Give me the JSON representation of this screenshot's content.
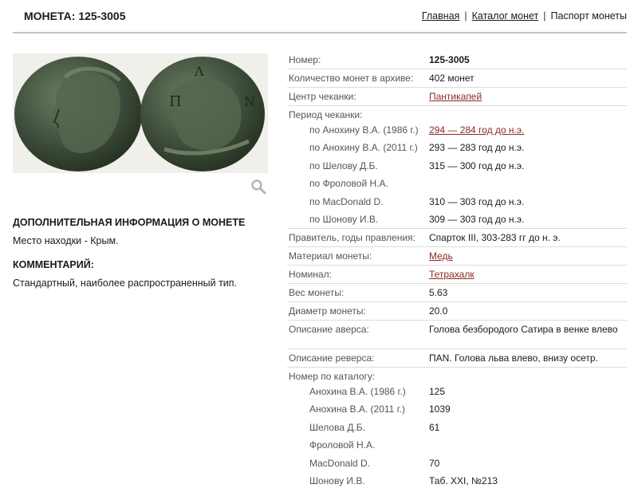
{
  "header": {
    "title": "МОНЕТА: 125-3005",
    "breadcrumb": {
      "home": "Главная",
      "catalog": "Каталог монет",
      "current": "Паспорт монеты",
      "separator": "|"
    }
  },
  "left": {
    "extra_heading": "ДОПОЛНИТЕЛЬНАЯ ИНФОРМАЦИЯ О МОНЕТЕ",
    "find_place": "Место находки - Крым.",
    "comment_heading": "КОММЕНТАРИЙ:",
    "comment": "Стандартный, наиболее распространенный тип.",
    "zoom_icon": "magnifier-icon",
    "coin_colors": {
      "metal": "#3e4e3c",
      "highlight": "#6d7d62",
      "background": "#f0efe9"
    }
  },
  "details": {
    "number": {
      "label": "Номер:",
      "value": "125-3005"
    },
    "count": {
      "label": "Количество монет в архиве:",
      "value": "402 монет"
    },
    "mint": {
      "label": "Центр чеканки:",
      "value": "Пантикапей"
    },
    "period": {
      "label": "Период чеканки:",
      "items": [
        {
          "label": "по Анохину В.А. (1986 г.)",
          "value": "294 — 284 год до н.э."
        },
        {
          "label": "по Анохину В.А. (2011 г.)",
          "value": "293 — 283 год до н.э."
        },
        {
          "label": "по Шелову Д.Б.",
          "value": "315 — 300 год до н.э."
        },
        {
          "label": "по Фроловой Н.А.",
          "value": ""
        },
        {
          "label": "по MacDonald D.",
          "value": "310 — 303 год до н.э."
        },
        {
          "label": "по Шонову И.В.",
          "value": "309 — 303 год до н.э."
        }
      ]
    },
    "ruler": {
      "label": "Правитель, годы правления:",
      "value": "Спарток III, 303-283 гг до н. э."
    },
    "material": {
      "label": "Материал монеты:",
      "value": "Медь"
    },
    "denomination": {
      "label": "Номинал:",
      "value": "Тетрахалк"
    },
    "weight": {
      "label": "Вес монеты:",
      "value": "5.63"
    },
    "diameter": {
      "label": "Диаметр монеты:",
      "value": "20.0"
    },
    "obverse": {
      "label": "Описание аверса:",
      "value": "Голова безбородого Сатира в венке влево"
    },
    "reverse": {
      "label": "Описание реверса:",
      "value": "ПАN. Голова льва влево, внизу осетр."
    },
    "catalog": {
      "label": "Номер по каталогу:",
      "items": [
        {
          "label": "Анохина В.А. (1986 г.)",
          "value": "125"
        },
        {
          "label": "Анохина В.А. (2011 г.)",
          "value": "1039"
        },
        {
          "label": "Шелова Д.Б.",
          "value": "61"
        },
        {
          "label": "Фроловой Н.А.",
          "value": ""
        },
        {
          "label": "MacDonald D.",
          "value": "70"
        },
        {
          "label": "Шонову И.В.",
          "value": "Таб. XXI, №213"
        }
      ]
    }
  }
}
